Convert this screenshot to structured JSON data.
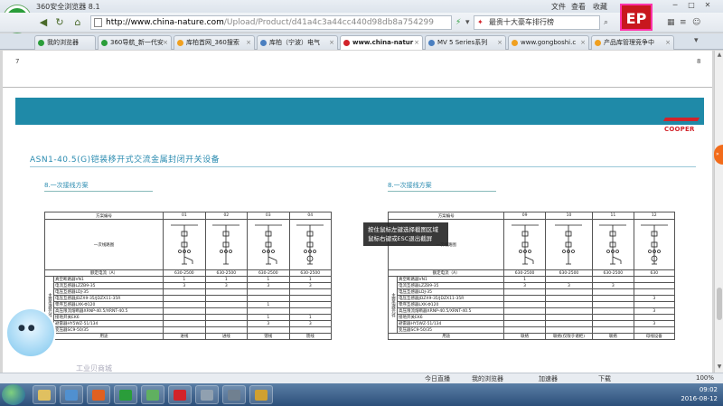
{
  "window": {
    "title": "360安全浏览器 8.1",
    "menu": [
      "文件",
      "查看",
      "收藏"
    ]
  },
  "address": {
    "url_domain": "http://www.china-nature.com",
    "url_rest": "/Upload/Product/d41a4c3a44cc440d98db8a754299",
    "search_text": "最贵十大豪车排行榜"
  },
  "tabs": [
    {
      "label": "我的浏览器",
      "color": "#2a9d3a"
    },
    {
      "label": "360导航_新一代安",
      "color": "#2a9d3a"
    },
    {
      "label": "库柏首网_360搜索",
      "color": "#f0a020"
    },
    {
      "label": "库柏（宁波）电气",
      "color": "#4a7fc0"
    },
    {
      "label": "www.china-natur",
      "color": "#d2232a",
      "active": true
    },
    {
      "label": "MV 5 Series系列",
      "color": "#4a7fc0"
    },
    {
      "label": "www.gongboshi.c",
      "color": "#f0a020"
    },
    {
      "label": "产品库管理竞争中",
      "color": "#f0a020"
    }
  ],
  "document": {
    "page_left": "7",
    "page_right": "8",
    "brand": "COOPER",
    "title": "ASN1-40.5(G)铠装移开式交流金属封闭开关设备",
    "section_left": "8.一次接线方案",
    "section_right": "8.一次接线方案",
    "table_left": {
      "header_label": "方案编号",
      "columns": [
        "01",
        "02",
        "03",
        "04"
      ],
      "diagram_label": "一次线路图",
      "rated_label": "额定电流（A）",
      "rated": [
        "630-2500",
        "630-2500",
        "630-2500",
        "630-2500"
      ],
      "group_label": "主要电器元件",
      "rows": [
        {
          "label": "真空断路器VN1",
          "vals": [
            "1",
            "1",
            "1",
            "1"
          ]
        },
        {
          "label": "电流互感器LZZB9-35",
          "vals": [
            "3",
            "3",
            "3",
            "3"
          ]
        },
        {
          "label": "电压互感器LDJ-35",
          "vals": [
            "",
            "",
            "",
            ""
          ]
        },
        {
          "label": "电压互感器JDZX9-35/JDZX11-35R",
          "vals": [
            "",
            "",
            "",
            ""
          ]
        },
        {
          "label": "零序互感器LXK-Φ120",
          "vals": [
            "",
            "",
            "1",
            ""
          ]
        },
        {
          "label": "高压限流熔断器XRNP-40.5/XRNT-40.5",
          "vals": [
            "",
            "",
            "",
            ""
          ]
        },
        {
          "label": "接地开关EK6",
          "vals": [
            "",
            "",
            "1",
            "1"
          ]
        },
        {
          "label": "避雷器HY5WZ-51/134",
          "vals": [
            "",
            "",
            "3",
            "3"
          ]
        },
        {
          "label": "变压器SC9-50/35",
          "vals": [
            "",
            "",
            "",
            ""
          ]
        }
      ],
      "use_label": "用途",
      "use": [
        "进线",
        "进线",
        "馈线",
        "馈线"
      ]
    },
    "table_right": {
      "header_label": "方案编号",
      "columns": [
        "09",
        "10",
        "11",
        "12"
      ],
      "diagram_label": "一次线路图",
      "rated_label": "额定电流（A）",
      "rated": [
        "630-2500",
        "630-2500",
        "630-2500",
        "630"
      ],
      "group_label": "主要电器元件",
      "rows": [
        {
          "label": "真空断路器VN1",
          "vals": [
            "1",
            "",
            "",
            ""
          ]
        },
        {
          "label": "电流互感器LZZB9-35",
          "vals": [
            "3",
            "3",
            "3",
            ""
          ]
        },
        {
          "label": "电压互感器LDJ-35",
          "vals": [
            "",
            "",
            "",
            ""
          ]
        },
        {
          "label": "电压互感器JDZX9-35/JDZX11-35R",
          "vals": [
            "",
            "",
            "",
            "3"
          ]
        },
        {
          "label": "零序互感器LXK-Φ120",
          "vals": [
            "",
            "",
            "",
            ""
          ]
        },
        {
          "label": "高压限流熔断器XRNP-40.5/XRNT-40.5",
          "vals": [
            "",
            "",
            "",
            "3"
          ]
        },
        {
          "label": "接地开关EK6",
          "vals": [
            "",
            "",
            "",
            ""
          ]
        },
        {
          "label": "避雷器HY5WZ-51/134",
          "vals": [
            "",
            "",
            "",
            "3"
          ]
        },
        {
          "label": "变压器SC9-50/35",
          "vals": [
            "",
            "",
            "",
            ""
          ]
        }
      ],
      "use_label": "用途",
      "use": [
        "联络",
        "联络(仅限于诸柜)",
        "联络",
        "母线设备"
      ]
    }
  },
  "tooltip": {
    "line1": "按住鼠标左键选择截图区域",
    "line2": "鼠标右键或ESC退出截屏"
  },
  "statusbar": {
    "today": "今日直播",
    "browser": "我的浏览器",
    "accelerator": "加速器",
    "download": "下载",
    "zoom": "100%"
  },
  "watermark": "工业贝商城",
  "taskbar": {
    "time": "09:02",
    "date": "2016-08-12"
  }
}
